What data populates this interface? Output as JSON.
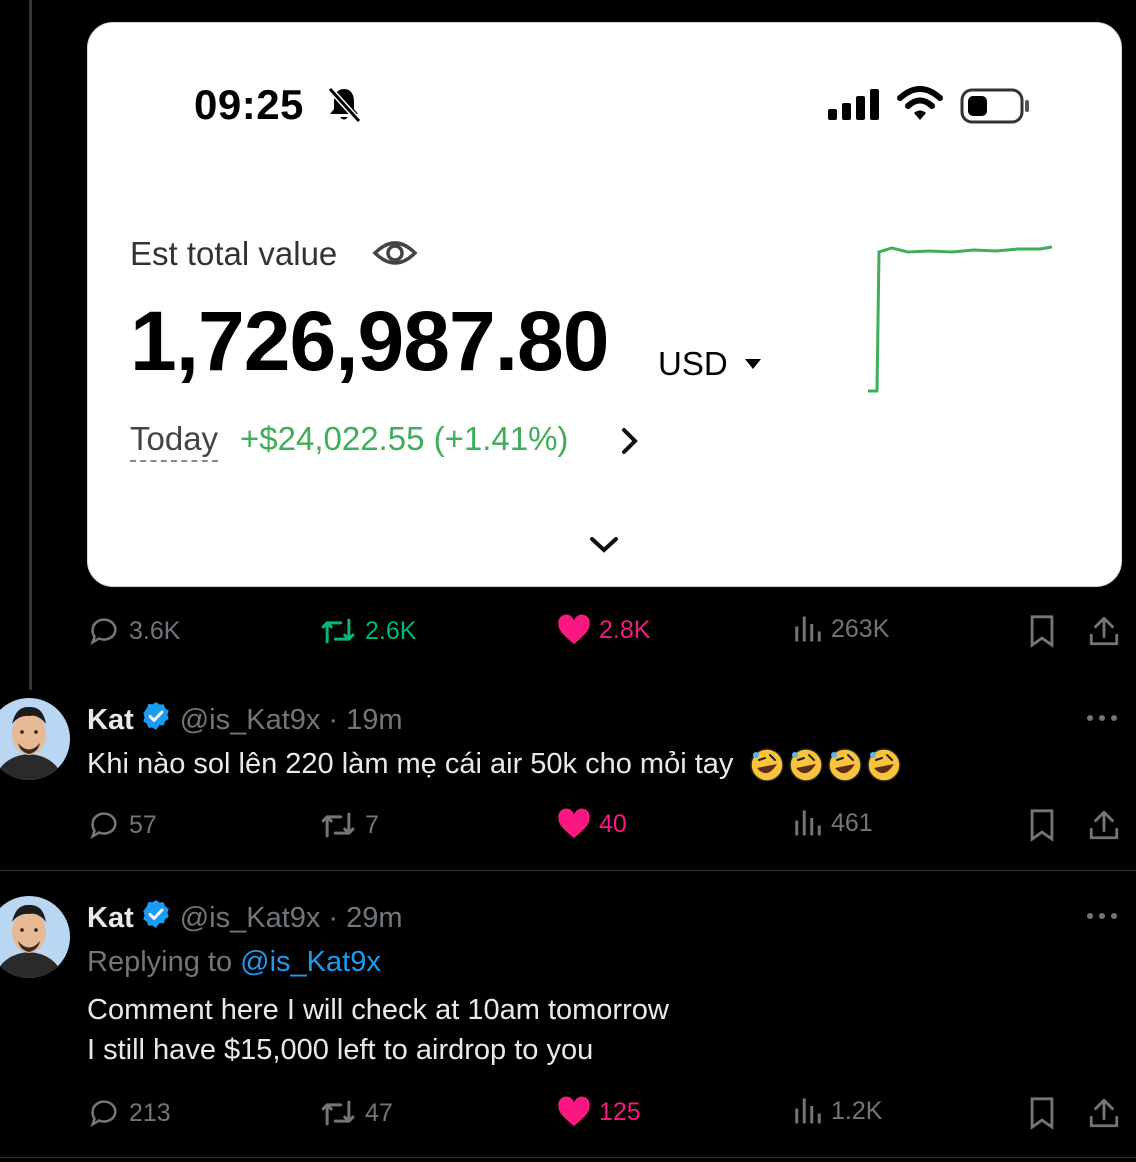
{
  "card": {
    "time": "09:25",
    "est_label": "Est total value",
    "value": "1,726,987.80",
    "currency": "USD",
    "today_label": "Today",
    "today_change": "+$24,022.55 (+1.41%)",
    "accent_green": "#3fae5a"
  },
  "main_actions": {
    "replies": "3.6K",
    "retweets": "2.6K",
    "likes": "2.8K",
    "views": "263K"
  },
  "tweets": [
    {
      "name": "Kat",
      "handle": "@is_Kat9x",
      "time": "· 19m",
      "text": "Khi nào sol lên 220 làm mẹ cái air 50k cho mỏi tay",
      "emoji": "rolling-on-floor-laughing x4",
      "replies": "57",
      "retweets": "7",
      "likes": "40",
      "views": "461"
    },
    {
      "name": "Kat",
      "handle": "@is_Kat9x",
      "time": "· 29m",
      "replying_prefix": "Replying to",
      "replying_handle": "@is_Kat9x",
      "line1": "Comment here I will check at 10am tomorrow",
      "line2": "I still have $15,000 left to airdrop to you",
      "replies": "213",
      "retweets": "47",
      "likes": "125",
      "views": "1.2K"
    }
  ],
  "colors": {
    "like": "#f91880",
    "retweet": "#00ba7c",
    "link": "#1d9bf0",
    "muted": "#71767b"
  }
}
